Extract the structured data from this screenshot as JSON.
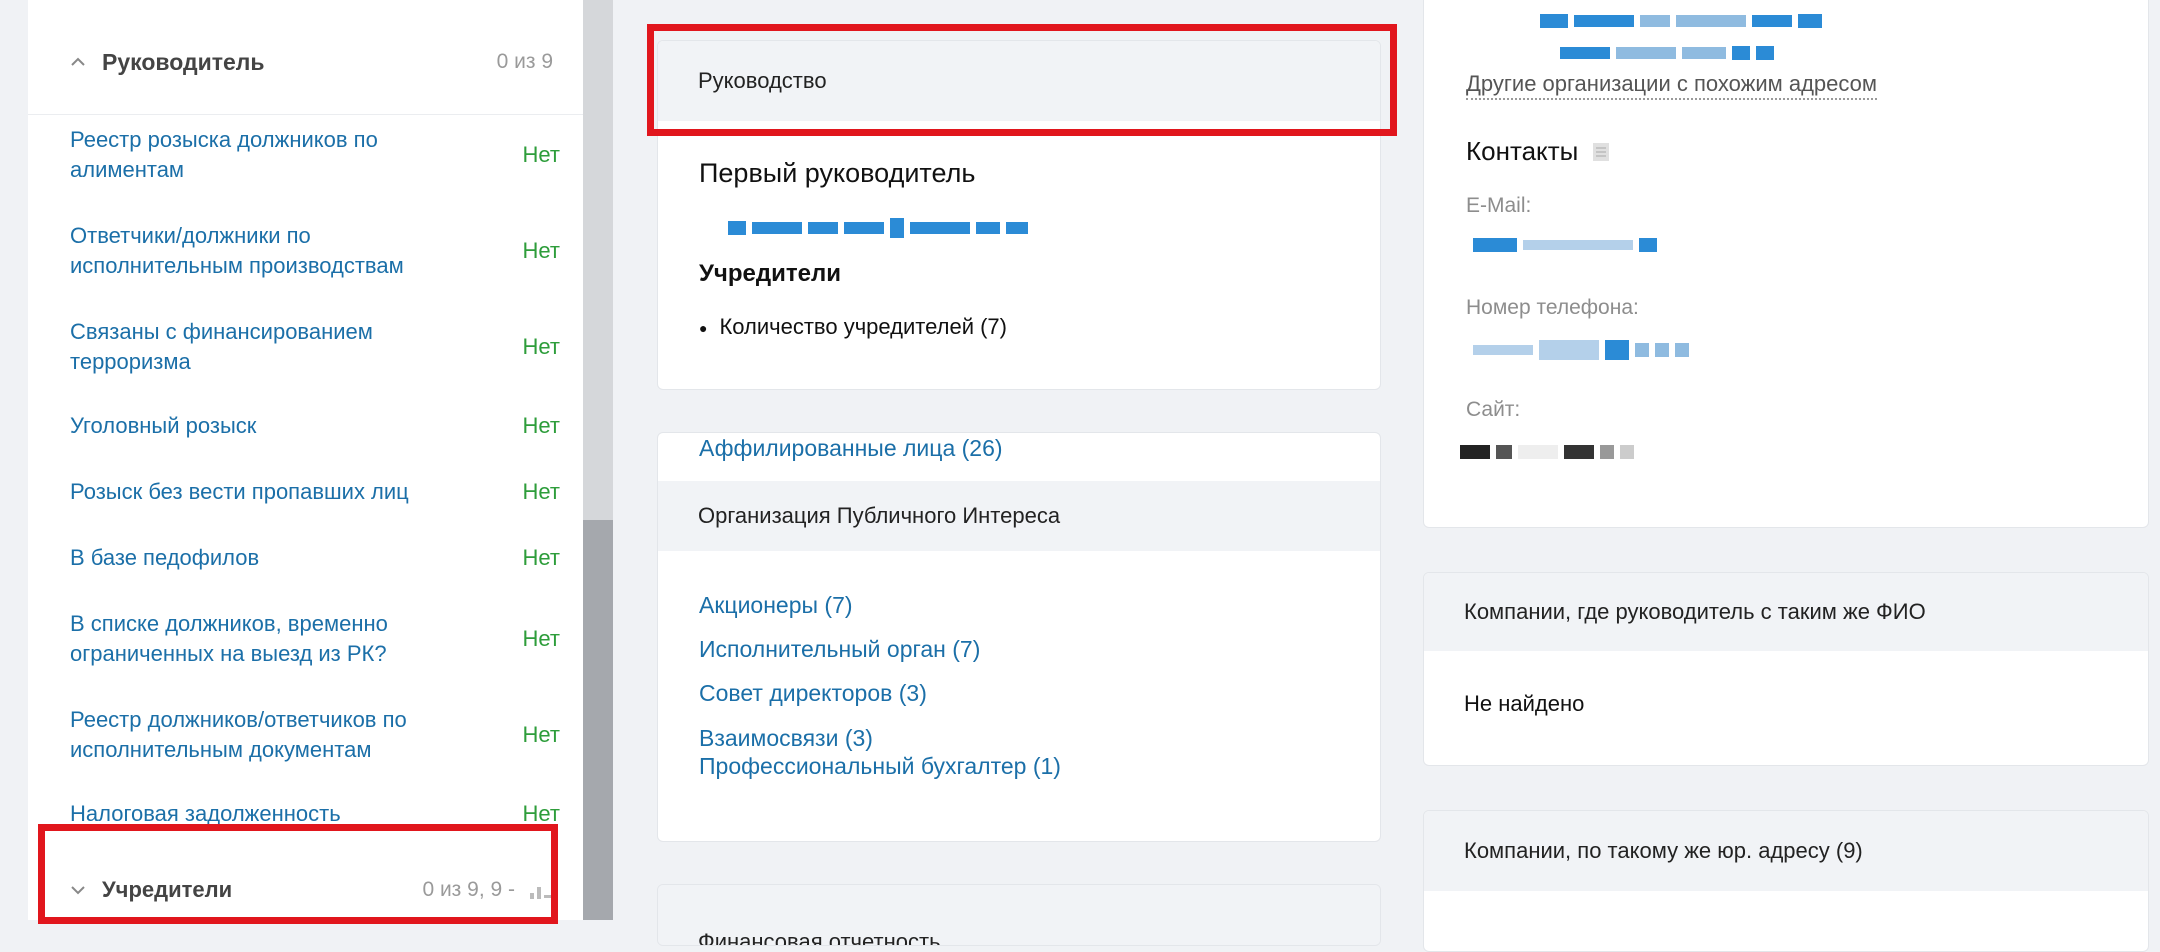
{
  "left_panel": {
    "section_title": "Руководитель",
    "section_count": "0 из 9",
    "items": [
      {
        "name": "Реестр розыска должников по алиментам",
        "value": "Нет"
      },
      {
        "name": "Ответчики/должники по исполнительным производствам",
        "value": "Нет"
      },
      {
        "name": "Связаны с финансированием терроризма",
        "value": "Нет"
      },
      {
        "name": "Уголовный розыск",
        "value": "Нет"
      },
      {
        "name": "Розыск без вести пропавших лиц",
        "value": "Нет"
      },
      {
        "name": "В базе педофилов",
        "value": "Нет"
      },
      {
        "name": "В списке должников, временно ограниченных на выезд из РК?",
        "value": "Нет"
      },
      {
        "name": "Реестр должников/ответчиков по исполнительным документам",
        "value": "Нет"
      },
      {
        "name": "Налоговая задолженность",
        "value": "Нет"
      }
    ],
    "bottom_section_title": "Учредители",
    "bottom_section_count": "0 из 9, 9 -"
  },
  "management_card": {
    "header": "Руководство",
    "first_head_label": "Первый руководитель",
    "founders_label": "Учредители",
    "founders_count": "Количество учредителей (7)"
  },
  "relations_card": {
    "affiliated": "Аффилированные лица (26)",
    "org_header": "Организация Публичного Интереса",
    "links": [
      "Акционеры (7)",
      "Исполнительный орган (7)",
      "Совет директоров (3)",
      "Взаимосвязи (3)",
      "Профессиональный бухгалтер (1)"
    ]
  },
  "financial_card": {
    "header": "Финансовая отчетность"
  },
  "contacts_card": {
    "similar_address_link": "Другие организации с похожим адресом",
    "title": "Контакты",
    "email_label": "E-Mail:",
    "phone_label": "Номер телефона:",
    "site_label": "Сайт:"
  },
  "same_name_card": {
    "header": "Компании, где руководитель с таким же ФИО",
    "body": "Не найдено"
  },
  "same_address_card": {
    "header": "Компании, по такому же юр. адресу (9)"
  },
  "colors": {
    "link": "#1b6fa8",
    "positive": "#2e9d3b",
    "highlight": "#e1161d",
    "card_header": "#f1f3f6"
  }
}
